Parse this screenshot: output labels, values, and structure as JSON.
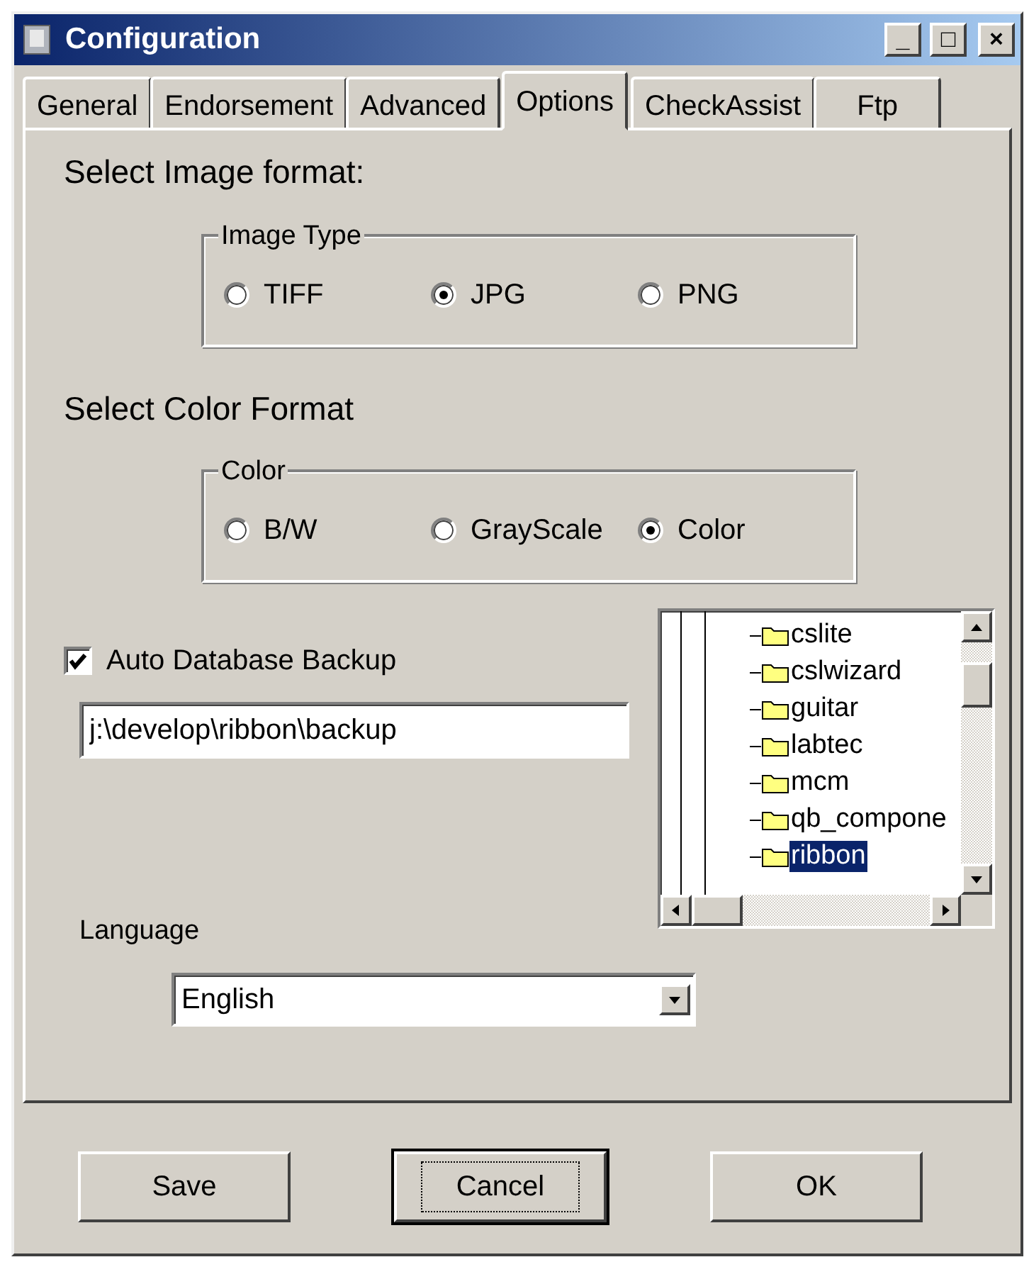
{
  "window": {
    "title": "Configuration",
    "controls": [
      "_",
      "□",
      "×"
    ]
  },
  "tabs": [
    {
      "label": "General",
      "selected": false
    },
    {
      "label": "Endorsement",
      "selected": false
    },
    {
      "label": "Advanced",
      "selected": false
    },
    {
      "label": "Options",
      "selected": true
    },
    {
      "label": "CheckAssist",
      "selected": false
    },
    {
      "label": "Ftp",
      "selected": false
    }
  ],
  "image_format": {
    "heading": "Select Image format:",
    "group": "Image Type",
    "options": [
      {
        "label": "TIFF",
        "selected": false
      },
      {
        "label": "JPG",
        "selected": true
      },
      {
        "label": "PNG",
        "selected": false
      }
    ]
  },
  "color_format": {
    "heading": "Select Color Format",
    "group": "Color",
    "options": [
      {
        "label": "B/W",
        "selected": false
      },
      {
        "label": "GrayScale",
        "selected": false
      },
      {
        "label": "Color",
        "selected": true
      }
    ]
  },
  "backup": {
    "label": "Auto Database Backup",
    "checked": true,
    "path": "j:\\develop\\ribbon\\backup"
  },
  "folder_tree": [
    {
      "label": "cslite",
      "selected": false
    },
    {
      "label": "cslwizard",
      "selected": false
    },
    {
      "label": "guitar",
      "selected": false
    },
    {
      "label": "labtec",
      "selected": false
    },
    {
      "label": "mcm",
      "selected": false
    },
    {
      "label": "qb_compone",
      "selected": false
    },
    {
      "label": "ribbon",
      "selected": true
    }
  ],
  "language": {
    "label": "Language",
    "value": "English"
  },
  "buttons": [
    {
      "label": "Save",
      "focused": false
    },
    {
      "label": "Cancel",
      "focused": true
    },
    {
      "label": "OK",
      "focused": false
    }
  ]
}
